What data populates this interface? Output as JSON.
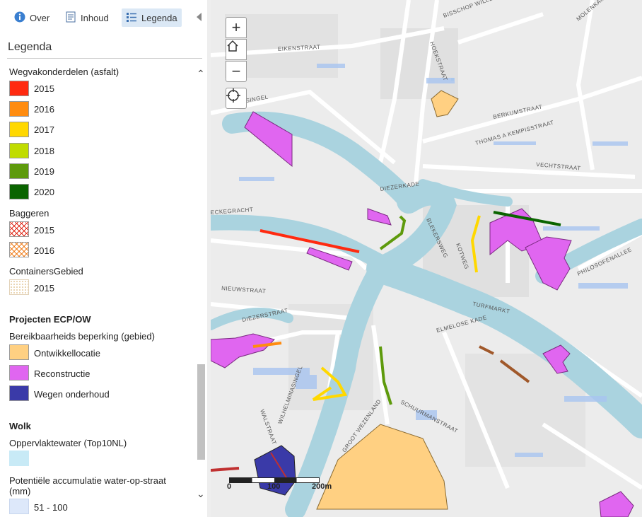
{
  "tabs": [
    {
      "label": "Over",
      "icon": "info-icon"
    },
    {
      "label": "Inhoud",
      "icon": "document-icon"
    },
    {
      "label": "Legenda",
      "icon": "list-icon",
      "active": true
    }
  ],
  "panel_title": "Legenda",
  "legend": {
    "wegvak": {
      "title": "Wegvakonderdelen (asfalt)",
      "items": [
        {
          "label": "2015",
          "color": "#ff2a10"
        },
        {
          "label": "2016",
          "color": "#ff8c10"
        },
        {
          "label": "2017",
          "color": "#ffd800"
        },
        {
          "label": "2018",
          "color": "#c0dc00"
        },
        {
          "label": "2019",
          "color": "#5e9a0c"
        },
        {
          "label": "2020",
          "color": "#0a6400"
        }
      ]
    },
    "baggeren": {
      "title": "Baggeren",
      "items": [
        {
          "label": "2015",
          "color": "#e03020"
        },
        {
          "label": "2016",
          "color": "#f08020"
        }
      ]
    },
    "containers": {
      "title": "ContainersGebied",
      "items": [
        {
          "label": "2015"
        }
      ]
    },
    "projecten": {
      "title": "Projecten ECP/OW",
      "subtitle": "Bereikbaarheids beperking (gebied)",
      "items": [
        {
          "label": "Ontwikkellocatie",
          "color": "#ffd082"
        },
        {
          "label": "Reconstructie",
          "color": "#e066f0"
        },
        {
          "label": "Wegen onderhoud",
          "color": "#3a3aa8"
        }
      ]
    },
    "wolk": {
      "title": "Wolk",
      "water_label": "Oppervlaktewater (Top10NL)",
      "water_color": "#c8eaf6",
      "accum_label": "Potentiële accumulatie water-op-straat (mm)",
      "accum_items": [
        {
          "label": "51 - 100",
          "color": "#dde8fa"
        }
      ]
    }
  },
  "map": {
    "zoom_in": "+",
    "zoom_out": "−",
    "scale_labels": [
      "0",
      "100",
      "200m"
    ],
    "water_color": "#aad3df",
    "streets": [
      "BISSCHOP",
      "WILLEBRANDLAAN",
      "EIKENSTRAAT",
      "HOEKSTRAAT",
      "BERKUMSTRAAT",
      "THOMAS A KEMPISSTRAAT",
      "VECHTSTRAAT",
      "DIEZERKADE",
      "BLEKERSWEG",
      "KOTWEG",
      "TURFMARKT",
      "NIEUWSTRAAT",
      "DIEZERSTRAAT",
      "SCHUURMANSTRAAT",
      "GROOT WEZENLAND",
      "ELMELOSE KADE",
      "PHILOSOFENALLEE",
      "WILHELMINASINGEL",
      "WALSTRAAT",
      "MOLENKAMPSWEG",
      "SINGEL",
      "ECKEGRACHT"
    ]
  }
}
